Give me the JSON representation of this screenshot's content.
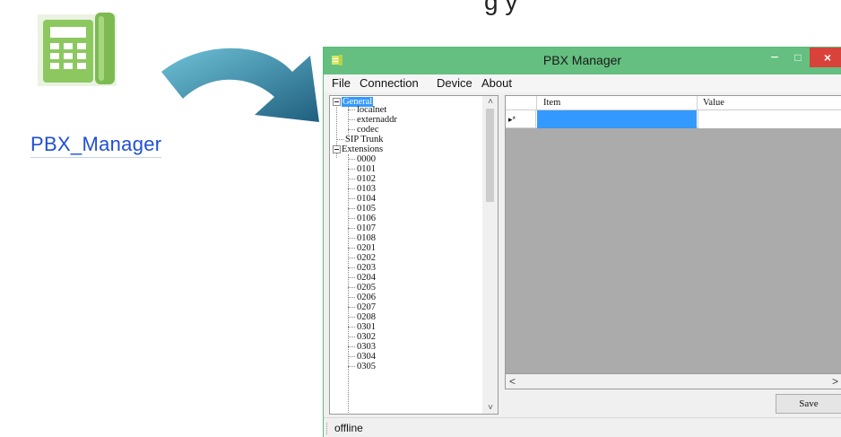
{
  "desktop": {
    "top_text": "g      y",
    "app_label": "PBX_Manager"
  },
  "window": {
    "title": "PBX Manager",
    "controls": {
      "minimize": "−",
      "maximize": "□",
      "close": "×"
    },
    "menu": [
      "File",
      "Connection",
      "Device",
      "About"
    ]
  },
  "tree": {
    "general": {
      "label": "General",
      "children": [
        "localnet",
        "externaddr",
        "codec"
      ]
    },
    "sip_trunk": "SIP Trunk",
    "extensions": {
      "label": "Extensions",
      "children": [
        "0000",
        "0101",
        "0102",
        "0103",
        "0104",
        "0105",
        "0106",
        "0107",
        "0108",
        "0201",
        "0202",
        "0203",
        "0204",
        "0205",
        "0206",
        "0207",
        "0208",
        "0301",
        "0302",
        "0303",
        "0304",
        "0305"
      ]
    }
  },
  "grid": {
    "columns": [
      "Item",
      "Value"
    ],
    "new_row_marker": "▸*"
  },
  "buttons": {
    "save": "Save"
  },
  "status": {
    "text": "offline"
  },
  "colors": {
    "titlebar": "#64bf80",
    "selection": "#3399ff",
    "close": "#d9423a",
    "link": "#1f4fd6",
    "arrow": "#2f7fa0"
  }
}
